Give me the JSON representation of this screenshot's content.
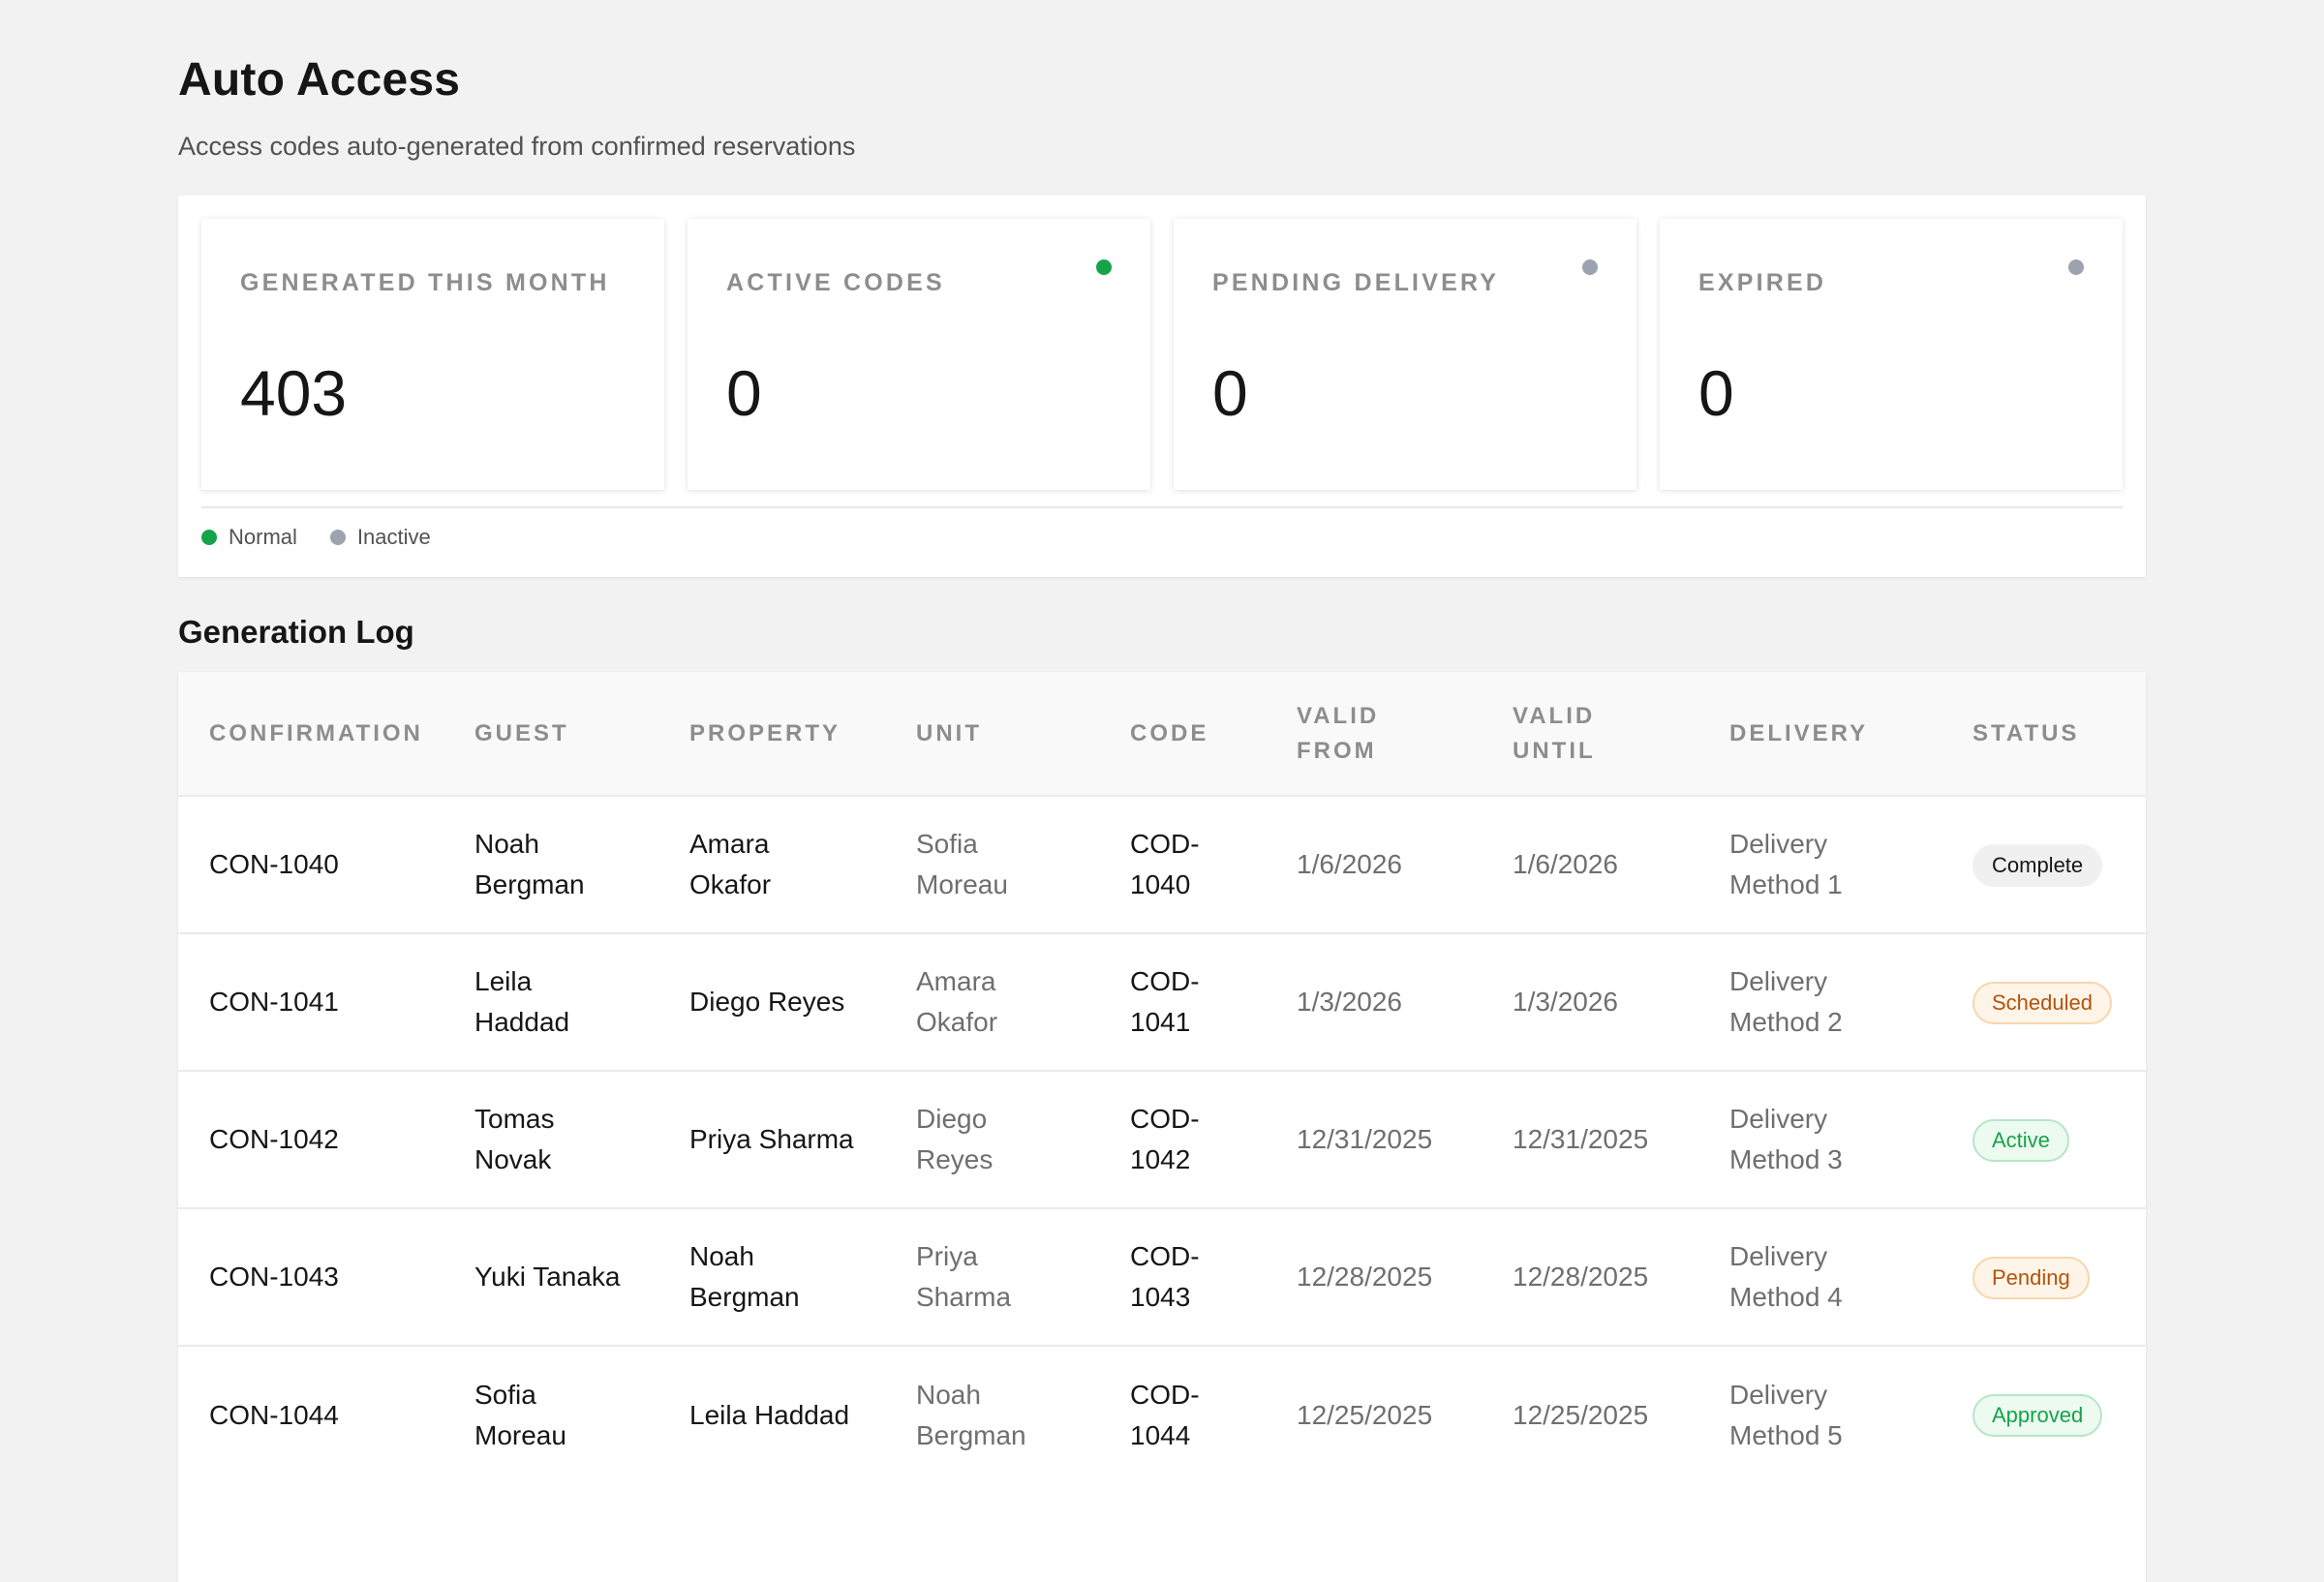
{
  "header": {
    "title": "Auto Access",
    "subtitle": "Access codes auto-generated from confirmed reservations"
  },
  "colors": {
    "normal": "#16a34a",
    "inactive": "#9ca3af"
  },
  "stats": [
    {
      "label": "GENERATED THIS MONTH",
      "value": "403",
      "dot": "none"
    },
    {
      "label": "ACTIVE CODES",
      "value": "0",
      "dot": "normal"
    },
    {
      "label": "PENDING DELIVERY",
      "value": "0",
      "dot": "inactive"
    },
    {
      "label": "EXPIRED",
      "value": "0",
      "dot": "inactive"
    }
  ],
  "legend": {
    "normal": "Normal",
    "inactive": "Inactive"
  },
  "log": {
    "title": "Generation Log",
    "columns": [
      "CONFIRMATION",
      "GUEST",
      "PROPERTY",
      "UNIT",
      "CODE",
      "VALID FROM",
      "VALID UNTIL",
      "DELIVERY",
      "STATUS"
    ],
    "rows": [
      {
        "confirmation": "CON-1040",
        "guest": "Noah Bergman",
        "property": "Amara Okafor",
        "unit": "Sofia Moreau",
        "code": "COD-1040",
        "valid_from": "1/6/2026",
        "valid_until": "1/6/2026",
        "delivery": "Delivery Method 1",
        "status": "Complete"
      },
      {
        "confirmation": "CON-1041",
        "guest": "Leila Haddad",
        "property": "Diego Reyes",
        "unit": "Amara Okafor",
        "code": "COD-1041",
        "valid_from": "1/3/2026",
        "valid_until": "1/3/2026",
        "delivery": "Delivery Method 2",
        "status": "Scheduled"
      },
      {
        "confirmation": "CON-1042",
        "guest": "Tomas Novak",
        "property": "Priya Sharma",
        "unit": "Diego Reyes",
        "code": "COD-1042",
        "valid_from": "12/31/2025",
        "valid_until": "12/31/2025",
        "delivery": "Delivery Method 3",
        "status": "Active"
      },
      {
        "confirmation": "CON-1043",
        "guest": "Yuki Tanaka",
        "property": "Noah Bergman",
        "unit": "Priya Sharma",
        "code": "COD-1043",
        "valid_from": "12/28/2025",
        "valid_until": "12/28/2025",
        "delivery": "Delivery Method 4",
        "status": "Pending"
      },
      {
        "confirmation": "CON-1044",
        "guest": "Sofia Moreau",
        "property": "Leila Haddad",
        "unit": "Noah Bergman",
        "code": "COD-1044",
        "valid_from": "12/25/2025",
        "valid_until": "12/25/2025",
        "delivery": "Delivery Method 5",
        "status": "Approved"
      }
    ]
  }
}
